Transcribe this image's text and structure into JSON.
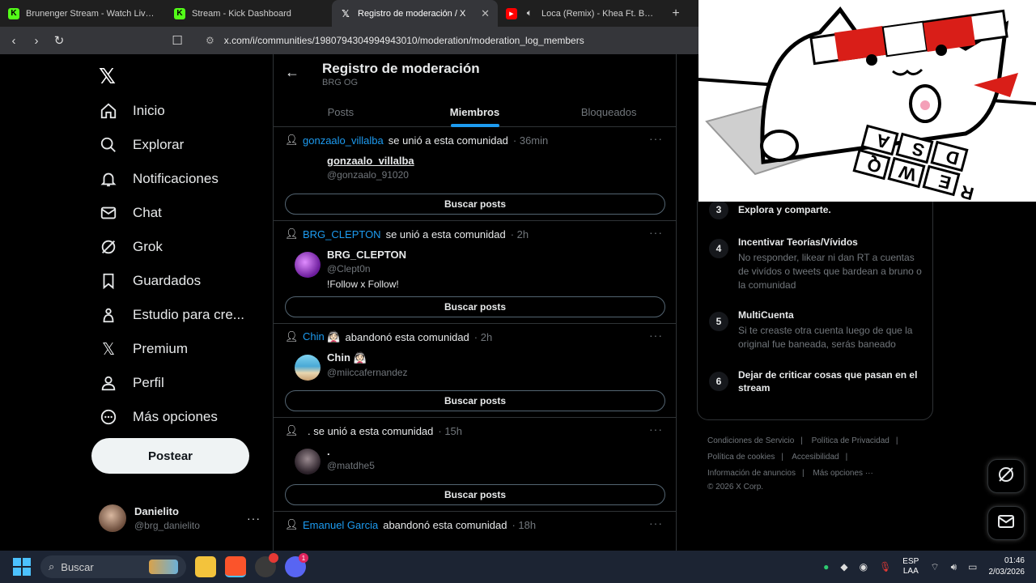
{
  "browser": {
    "tabs": [
      {
        "title": "Brunenger Stream - Watch Live on Ki",
        "favicon": "kick-icon",
        "color": "#53fc18"
      },
      {
        "title": "Stream - Kick Dashboard",
        "favicon": "kick-icon",
        "color": "#53fc18"
      },
      {
        "title": "Registro de moderación / X",
        "favicon": "x-icon",
        "active": true
      },
      {
        "title": "Loca (Remix) - Khea Ft. Bad Bunn",
        "favicon": "youtube-icon",
        "color": "#ff0000"
      }
    ],
    "url": "x.com/i/communities/1980794304994943010/moderation/moderation_log_members"
  },
  "nav": {
    "items": [
      {
        "label": "Inicio",
        "icon": "home-icon"
      },
      {
        "label": "Explorar",
        "icon": "search-icon"
      },
      {
        "label": "Notificaciones",
        "icon": "bell-icon"
      },
      {
        "label": "Chat",
        "icon": "mail-icon"
      },
      {
        "label": "Grok",
        "icon": "grok-icon"
      },
      {
        "label": "Guardados",
        "icon": "bookmark-icon"
      },
      {
        "label": "Estudio para cre...",
        "icon": "studio-icon"
      },
      {
        "label": "Premium",
        "icon": "x-icon"
      },
      {
        "label": "Perfil",
        "icon": "person-icon"
      },
      {
        "label": "Más opciones",
        "icon": "more-circle-icon"
      }
    ],
    "post_label": "Postear",
    "user": {
      "name": "Danielito",
      "handle": "@brg_danielito"
    }
  },
  "header": {
    "title": "Registro de moderación",
    "subtitle": "BRG OG",
    "tabs": [
      "Posts",
      "Miembros",
      "Bloqueados"
    ],
    "active_tab": "Miembros"
  },
  "log": [
    {
      "user_link": "gonzaalo_villalba",
      "action": "se unió a esta comunidad",
      "time": "· 36min",
      "name": "gonzaalo_villalba",
      "handle": "@gonzaalo_91020",
      "bio": "",
      "avatar": "",
      "button": "Buscar posts"
    },
    {
      "user_link": "BRG_CLEPTON",
      "action": "se unió a esta comunidad",
      "time": "· 2h",
      "name": "BRG_CLEPTON",
      "handle": "@Clept0n",
      "bio": "!Follow x Follow!",
      "avatar": "purple",
      "button": "Buscar posts"
    },
    {
      "user_link": "Chin 👰🏻",
      "action": "abandonó esta comunidad",
      "time": "· 2h",
      "name": "Chin 👰🏻",
      "handle": "@miiccafernandez",
      "bio": "",
      "avatar": "beach",
      "button": "Buscar posts"
    },
    {
      "user_link": "",
      "action": ". se unió a esta comunidad",
      "time": "· 15h",
      "name": ".",
      "handle": "@matdhe5",
      "bio": "",
      "avatar": "dark",
      "button": "Buscar posts"
    },
    {
      "user_link": "Emanuel Garcia",
      "action": "abandonó esta comunidad",
      "time": "· 18h",
      "name": "",
      "handle": "",
      "bio": "",
      "avatar": "",
      "button": ""
    }
  ],
  "rules": [
    {
      "num": "3",
      "title": "Explora y comparte.",
      "desc": ""
    },
    {
      "num": "4",
      "title": "Incentivar Teorías/Vívidos",
      "desc": "No responder, likear ni dan RT a cuentas de vivídos o tweets que bardean a bruno o la comunidad"
    },
    {
      "num": "5",
      "title": "MultiCuenta",
      "desc": "Si te creaste otra cuenta luego de que la original fue baneada, serás baneado"
    },
    {
      "num": "6",
      "title": "Dejar de criticar cosas que pasan en el stream",
      "desc": ""
    }
  ],
  "footer": {
    "links": [
      "Condiciones de Servicio",
      "Política de Privacidad",
      "Política de cookies",
      "Accesibilidad",
      "Información de anuncios",
      "Más opciones ···"
    ],
    "copyright": "© 2026 X Corp."
  },
  "overlay": {
    "keys": [
      "A",
      "S",
      "D",
      "Q",
      "W",
      "E",
      "R"
    ]
  },
  "taskbar": {
    "search_placeholder": "Buscar",
    "lang_top": "ESP",
    "lang_bottom": "LAA",
    "time": "01:46",
    "date": "2/03/2026",
    "discord_badge": "1"
  },
  "colors": {
    "accent": "#1d9bf0",
    "background": "#000000",
    "border": "#2f3336",
    "muted": "#71767b"
  }
}
